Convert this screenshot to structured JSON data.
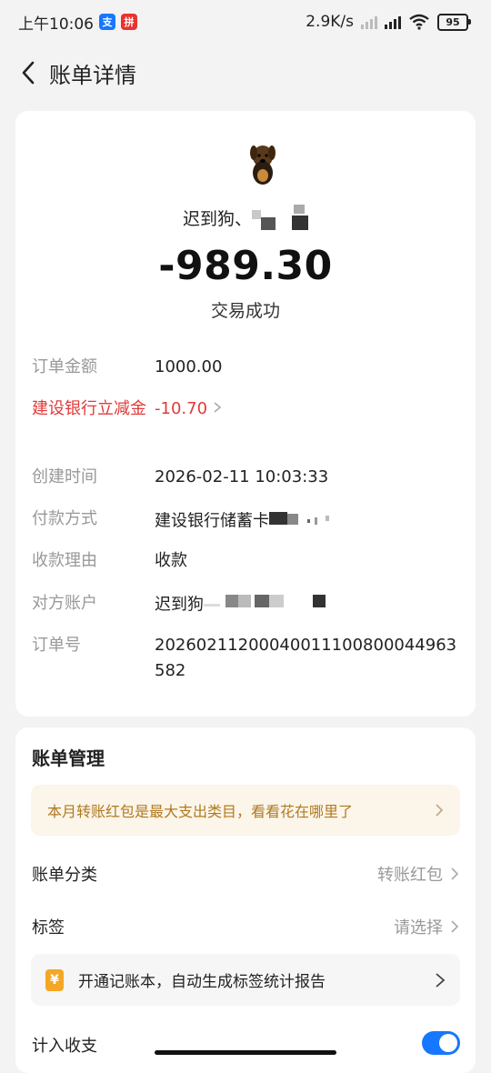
{
  "status_bar": {
    "time": "上午10:06",
    "app1_glyph": "支",
    "app2_glyph": "拼",
    "net_speed": "2.9K/s",
    "battery": "95",
    "icons": [
      "alipay-notification-icon",
      "pinduoduo-notification-icon",
      "signal-weak-icon",
      "hd-signal-icon",
      "wifi-icon",
      "battery-icon"
    ]
  },
  "header": {
    "title": "账单详情",
    "back_icon": "chevron-left-icon"
  },
  "summary": {
    "payee_name": "迟到狗、",
    "amount": "-989.30",
    "status": "交易成功"
  },
  "details": [
    {
      "label": "订单金额",
      "value": "1000.00"
    },
    {
      "label": "建设银行立减金",
      "value": "-10.70",
      "color": "#e23a3a"
    },
    {
      "label": "创建时间",
      "value": "2026-02-11 10:03:33"
    },
    {
      "label": "付款方式",
      "value": "建设银行储蓄卡"
    },
    {
      "label": "收款理由",
      "value": "收款"
    },
    {
      "label": "对方账户",
      "value": "迟到狗"
    },
    {
      "label": "订单号",
      "value": "20260211200040011100800044963582"
    }
  ],
  "management": {
    "title": "账单管理",
    "tip": "本月转账红包是最大支出类目，看看花在哪里了",
    "category_label": "账单分类",
    "category_value": "转账红包",
    "tag_label": "标签",
    "tag_value": "请选择",
    "ledger_icon": "¥",
    "ledger_text": "开通记账本，自动生成标签统计报告",
    "include_label": "计入收支",
    "include_enabled": true
  },
  "colors": {
    "accent": "#1677ff",
    "discount_red": "#e23a3a",
    "tip_text": "#b07a1f"
  }
}
